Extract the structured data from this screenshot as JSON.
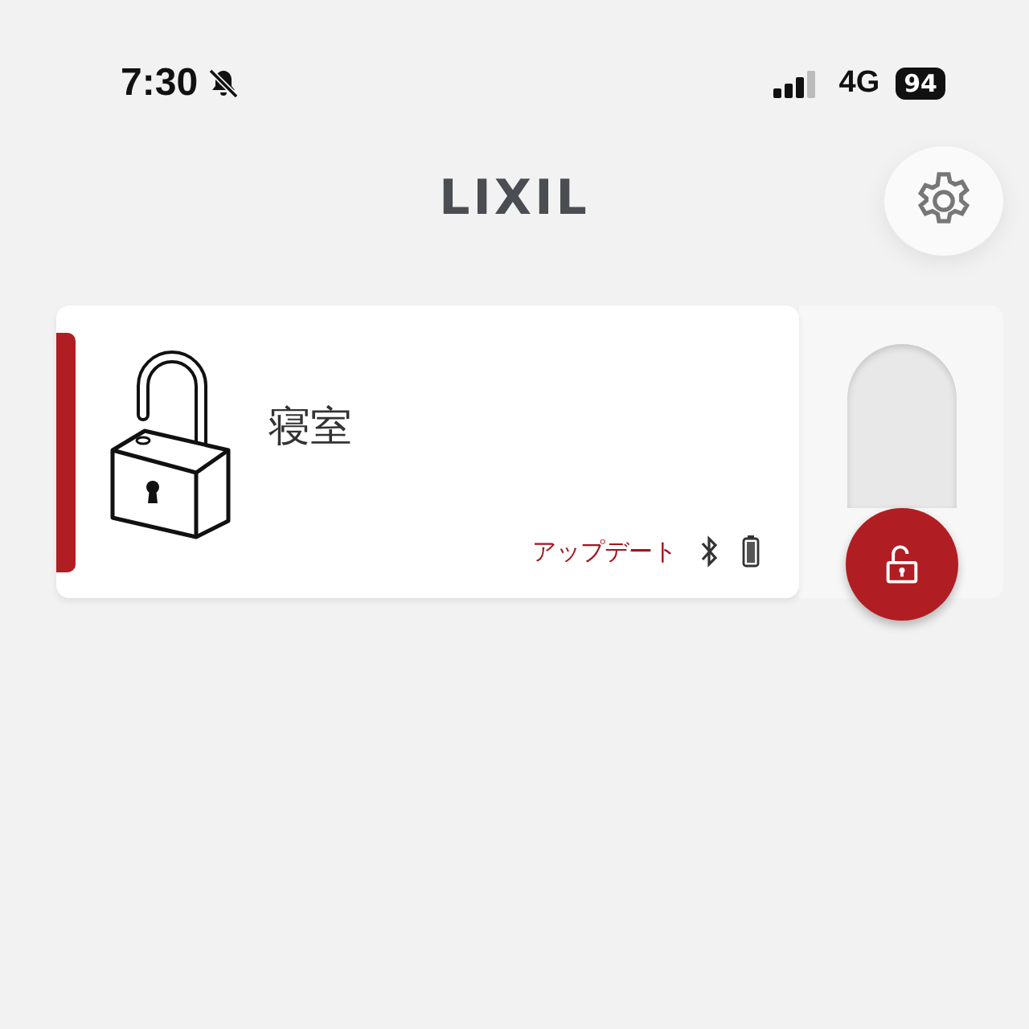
{
  "status_bar": {
    "time": "7:30",
    "silent": true,
    "network": "4G",
    "battery": "94"
  },
  "header": {
    "logo": "LIXIL"
  },
  "devices": [
    {
      "name": "寝室",
      "locked": false,
      "update_label": "アップデート"
    }
  ]
}
